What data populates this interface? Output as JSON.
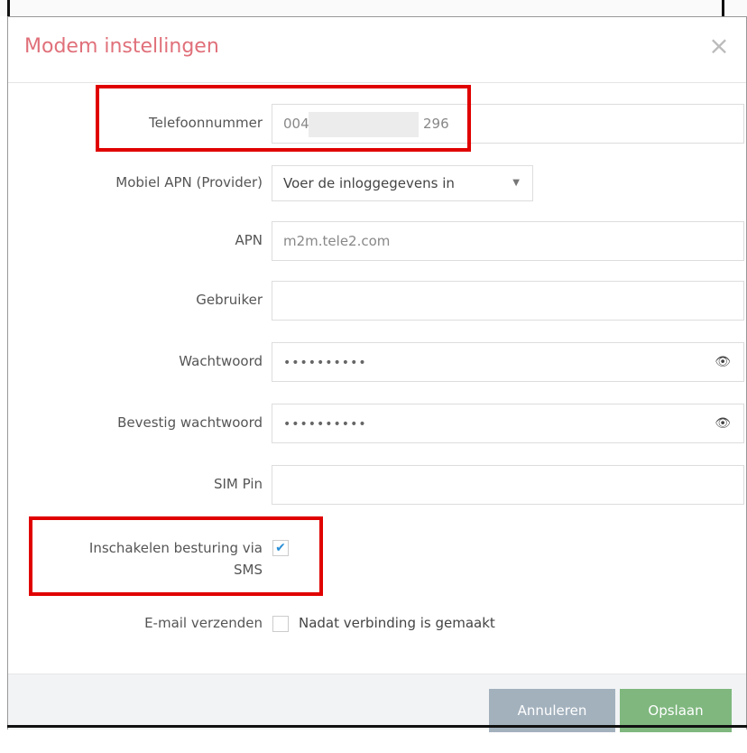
{
  "modal": {
    "title": "Modem instellingen",
    "close_label": "×"
  },
  "fields": {
    "phone": {
      "label": "Telefoonnummer",
      "value_prefix": "004",
      "value_suffix": "296"
    },
    "apn_provider": {
      "label": "Mobiel APN (Provider)",
      "selected": "Voer de inloggegevens in",
      "caret": "▼"
    },
    "apn": {
      "label": "APN",
      "value": "m2m.tele2.com"
    },
    "user": {
      "label": "Gebruiker",
      "value": ""
    },
    "password": {
      "label": "Wachtwoord",
      "value": "••••••••••",
      "eye": "👁"
    },
    "confirm_password": {
      "label": "Bevestig wachtwoord",
      "value": "••••••••••",
      "eye": "👁"
    },
    "sim_pin": {
      "label": "SIM Pin",
      "value": ""
    },
    "sms_control": {
      "label_line1": "Inschakelen besturing via",
      "label_line2": "SMS",
      "checked": true,
      "check_glyph": "✔"
    },
    "email": {
      "label": "E-mail verzenden",
      "option_label": "Nadat verbinding is gemaakt",
      "checked": false
    }
  },
  "footer": {
    "cancel_label": "Annuleren",
    "save_label": "Opslaan"
  },
  "colors": {
    "title": "#e0707a",
    "cancel_button": "#a3b1bd",
    "save_button": "#7fb77e",
    "checkbox_check": "#2a8fd7",
    "highlight_box": "#e00000"
  }
}
